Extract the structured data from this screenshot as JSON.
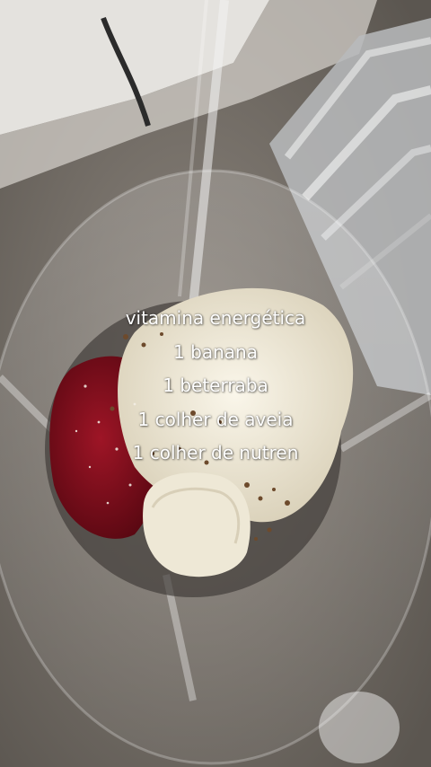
{
  "story": {
    "caption_lines": [
      "vitamina energética",
      "1 banana",
      "1 beterraba",
      "1 colher de aveia",
      "1 colher de nutren"
    ]
  },
  "colors": {
    "caption_text": "#ffffff",
    "beet": "#8a0d1e",
    "banana": "#efe9d8",
    "oat_powder": "#f2ecd9",
    "countertop": "#7d766f",
    "wall": "#e6e4e0"
  }
}
